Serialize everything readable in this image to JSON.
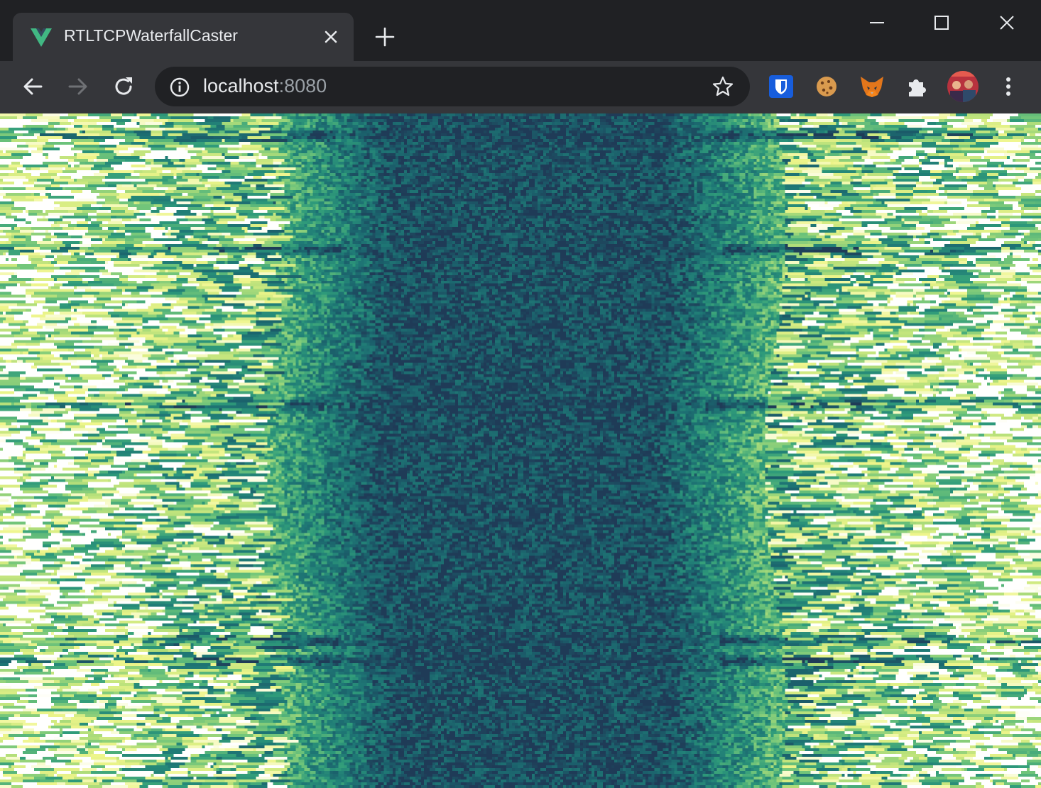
{
  "tab": {
    "title": "RTLTCPWaterfallCaster",
    "favicon": "vue-logo-icon"
  },
  "toolbar": {
    "url_host": "localhost",
    "url_port": ":8080"
  },
  "extensions": [
    "bitwarden-icon",
    "cookie-icon",
    "metamask-fox-icon",
    "puzzle-extensions-icon"
  ],
  "colors": {
    "titlebar_bg": "#202124",
    "tab_bg": "#35363a",
    "omnibox_bg": "#202124",
    "accent_vue": "#41b883",
    "waterfall_colormap": [
      "#1f3b57",
      "#1b5f6b",
      "#1f7a76",
      "#2f9b7a",
      "#6fc47a",
      "#b7e07a",
      "#eef58a",
      "#ffffff"
    ]
  }
}
